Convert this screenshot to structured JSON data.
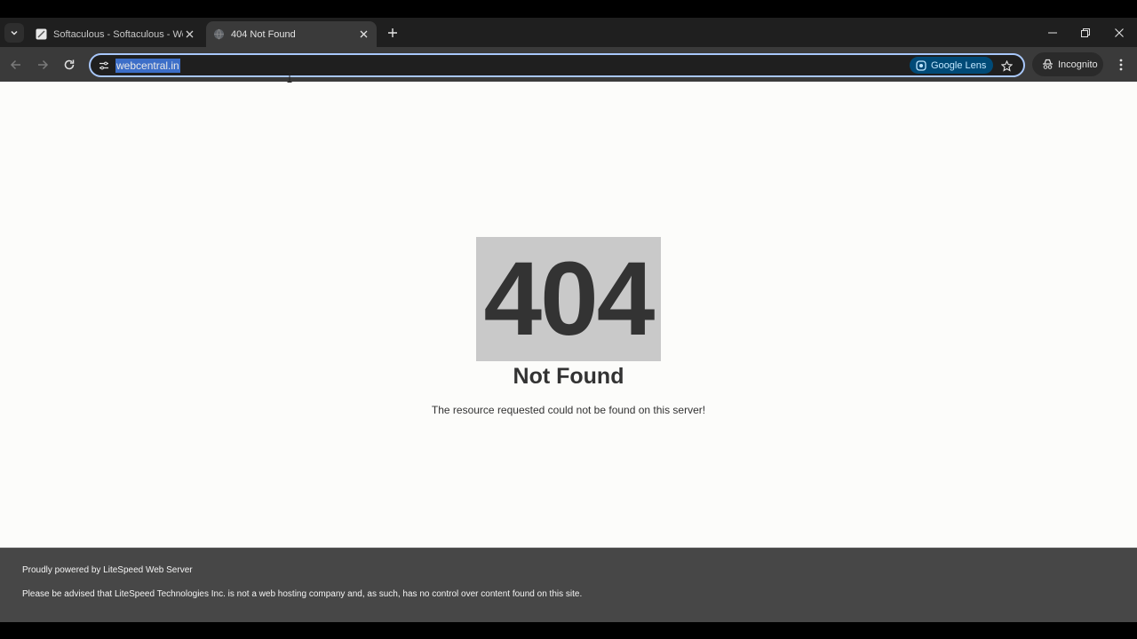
{
  "tabs": [
    {
      "title": "Softaculous - Softaculous - WordPress",
      "favicon": "softaculous-icon",
      "active": false
    },
    {
      "title": "404 Not Found",
      "favicon": "globe-icon",
      "active": true
    }
  ],
  "toolbar": {
    "url": "webcentral.in",
    "lens_label": "Google Lens",
    "profile_label": "Incognito"
  },
  "page": {
    "code": "404",
    "title": "Not Found",
    "message": "The resource requested could not be found on this server!"
  },
  "footer": {
    "powered": "Proudly powered by LiteSpeed Web Server",
    "notice": "Please be advised that LiteSpeed Technologies Inc. is not a web hosting company and, as such, has no control over content found on this site."
  },
  "colors": {
    "accent": "#a8c7fa",
    "selection": "#3c6ec8",
    "footer_bg": "#474747",
    "code_bg": "#c9c9c9"
  }
}
